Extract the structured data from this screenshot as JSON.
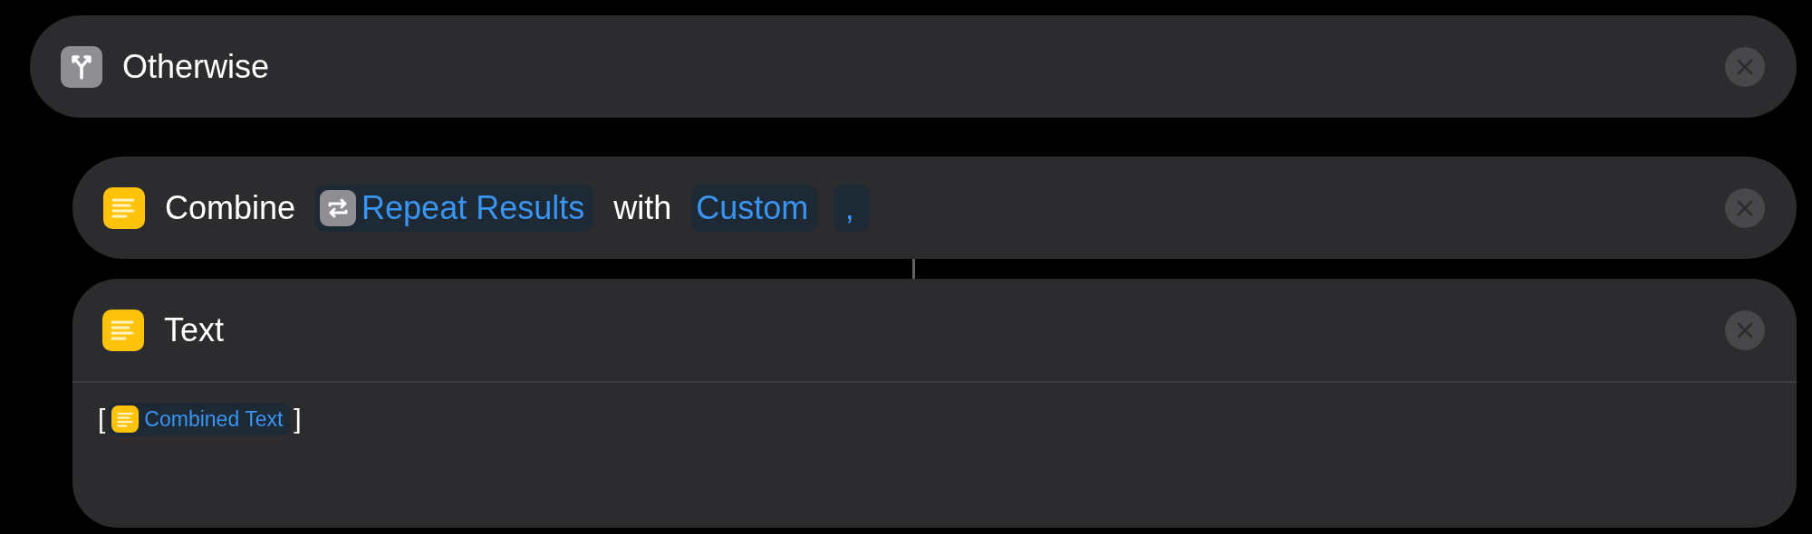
{
  "blocks": [
    {
      "kind": "header",
      "title": "Otherwise",
      "children": [
        {
          "kind": "parameters",
          "parts": [
            {
              "kind": "label",
              "text": "Combine"
            },
            {
              "kind": "variable",
              "text": "Repeat Results"
            },
            {
              "kind": "label",
              "text": "with"
            },
            {
              "kind": "option",
              "text": "Custom"
            },
            {
              "kind": "option",
              "text": ","
            }
          ]
        },
        {
          "kind": "body",
          "title": "Text",
          "body": [
            {
              "kind": "bracket",
              "text": "["
            },
            {
              "kind": "variable",
              "text": "Combined Text"
            },
            {
              "kind": "bracket",
              "text": "]"
            }
          ]
        }
      ]
    }
  ]
}
